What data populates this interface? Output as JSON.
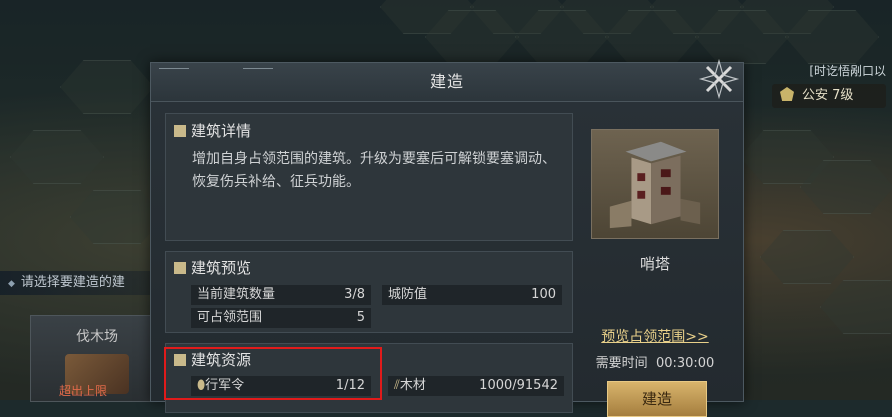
{
  "background": {
    "left_hint": "请选择要建造的建",
    "lumber_card_label": "伐木场",
    "lumber_card_status": "超出上限",
    "right_tag": "[时讫悟剐口以",
    "security_level": "公安 7级"
  },
  "dialog": {
    "title": "建造",
    "details": {
      "title": "建筑详情",
      "description": "增加自身占领范围的建筑。升级为要塞后可解锁要塞调动、恢复伤兵补给、征兵功能。"
    },
    "preview": {
      "title": "建筑预览",
      "stats": [
        {
          "label": "当前建筑数量",
          "value": "3/8"
        },
        {
          "label": "城防值",
          "value": "100"
        },
        {
          "label": "可占领范围",
          "value": "5"
        }
      ]
    },
    "resources": {
      "title": "建筑资源",
      "items": [
        {
          "label": "行军令",
          "value": "1/12"
        },
        {
          "label": "木材",
          "value": "1000/91542"
        }
      ]
    },
    "building": {
      "name": "哨塔",
      "preview_link": "预览占领范围>>",
      "time_label": "需要时间",
      "time_value": "00:30:00",
      "build_button": "建造"
    }
  },
  "colors": {
    "highlight": "#e01b1b",
    "accent_gold": "#e8d08a",
    "button_gold": "#d8b46c"
  }
}
